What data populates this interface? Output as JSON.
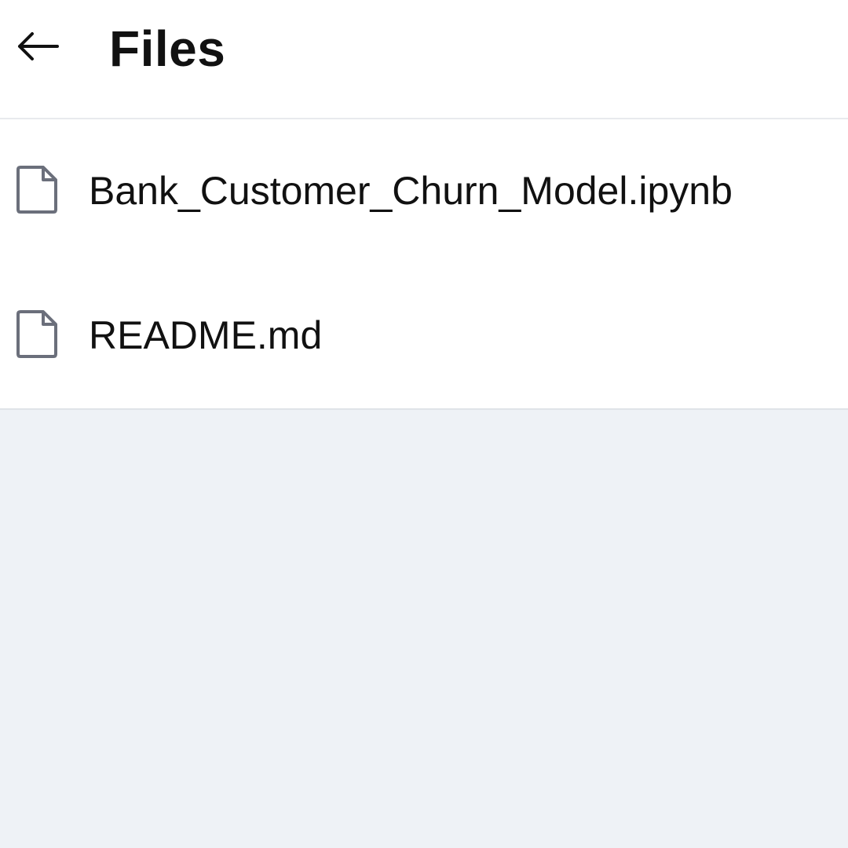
{
  "header": {
    "title": "Files",
    "back_icon": "arrow-left-icon"
  },
  "files": [
    {
      "name": "Bank_Customer_Churn_Model.ipynb",
      "icon": "file-icon"
    },
    {
      "name": "README.md",
      "icon": "file-icon"
    }
  ],
  "colors": {
    "header_background": "#ffffff",
    "page_background": "#eef2f6",
    "text": "#111111",
    "icon": "#6b6f7b"
  }
}
